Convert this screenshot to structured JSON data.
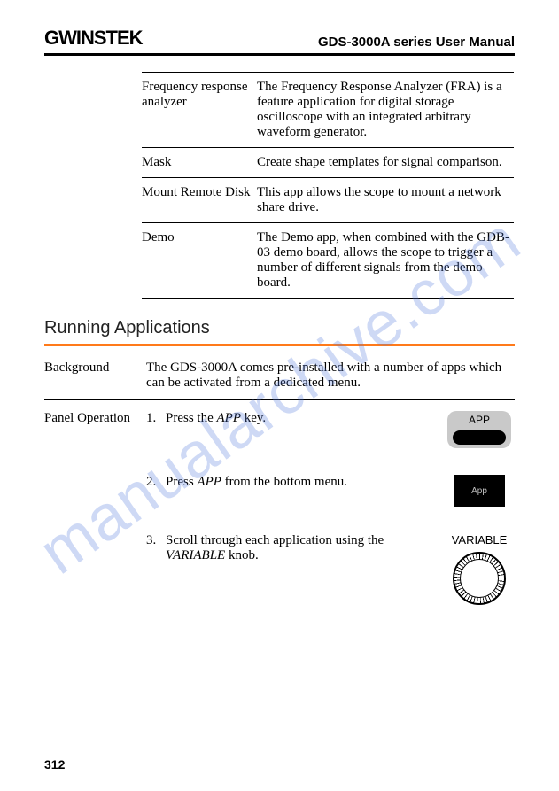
{
  "header": {
    "brand": "GWINSTEK",
    "title": "GDS-3000A series User Manual"
  },
  "features": [
    {
      "term": "Frequency response analyzer",
      "desc": "The Frequency Response Analyzer (FRA) is a feature application for digital storage oscilloscope with an integrated arbitrary waveform generator."
    },
    {
      "term": "Mask",
      "desc": "Create shape templates for signal comparison."
    },
    {
      "term": "Mount Remote Disk",
      "desc": "This app allows the scope to mount a network share drive."
    },
    {
      "term": "Demo",
      "desc": "The Demo app, when combined with the GDB-03 demo board, allows the scope to trigger a number of different signals from the demo board."
    }
  ],
  "section_heading": "Running Applications",
  "background": {
    "label": "Background",
    "text": "The GDS-3000A comes pre-installed with a number of apps which can be activated from a dedicated menu."
  },
  "panel_operation": {
    "label": "Panel Operation",
    "steps": [
      {
        "num": "1.",
        "prefix": "Press the ",
        "em": "APP",
        "suffix": " key."
      },
      {
        "num": "2.",
        "prefix": "Press ",
        "em": "APP",
        "suffix": " from the bottom menu."
      },
      {
        "num": "3.",
        "prefix": "Scroll through each application using the ",
        "em": "VARIABLE",
        "suffix": " knob."
      }
    ],
    "app_key_label": "APP",
    "menu_btn_label": "App",
    "variable_label": "VARIABLE"
  },
  "page_number": "312",
  "watermark_text": "manualarchive.com"
}
